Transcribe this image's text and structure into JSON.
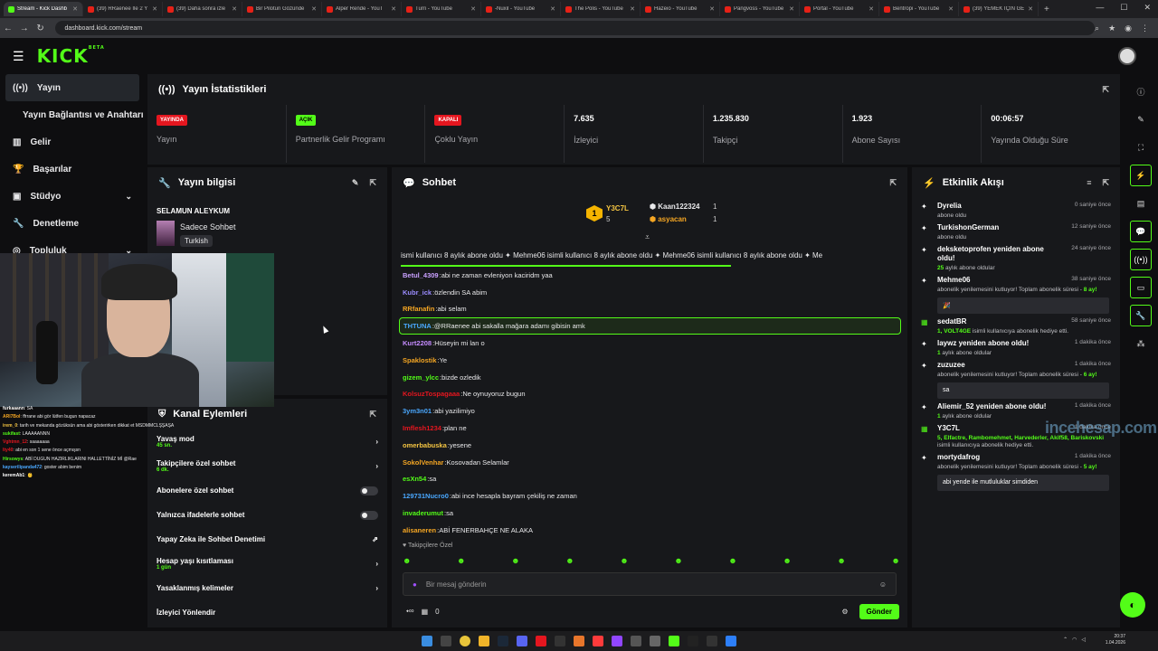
{
  "browser": {
    "tabs": [
      {
        "label": "Stream - Kick Dashb",
        "active": true
      },
      {
        "label": "(39) RRaenee İle 2 Y"
      },
      {
        "label": "(39) Daha sonra izle"
      },
      {
        "label": "Bir Pilotun Gözünde"
      },
      {
        "label": "Alper Rende - YouT"
      },
      {
        "label": "Turri - YouTube"
      },
      {
        "label": "-Nuxil - YouTube"
      },
      {
        "label": "The Polis - YouTube"
      },
      {
        "label": "Hazeio - YouTube"
      },
      {
        "label": "Pangvoss - YouTube"
      },
      {
        "label": "Portal - YouTube"
      },
      {
        "label": "Bentropi - YouTube"
      },
      {
        "label": "(39) YEMEK İÇİN GE"
      }
    ],
    "new_tab": "+",
    "url": "dashboard.kick.com/stream"
  },
  "app": {
    "logo": "KICK",
    "logo_beta": "BETA"
  },
  "sidebar": {
    "items": [
      {
        "label": "Yayın",
        "icon": "broadcast-icon"
      },
      {
        "label": "Yayın Bağlantısı ve Anahtarı"
      },
      {
        "label": "Gelir",
        "icon": "chart-icon"
      },
      {
        "label": "Başarılar",
        "icon": "trophy-icon"
      },
      {
        "label": "Stüdyo",
        "icon": "studio-icon"
      },
      {
        "label": "Denetleme",
        "icon": "wrench-icon"
      },
      {
        "label": "Topluluk",
        "icon": "community-icon"
      }
    ]
  },
  "stats": {
    "title": "Yayın İstatistikleri",
    "items": [
      {
        "badge": "YAYINDA",
        "label": "Yayın"
      },
      {
        "badge": "AÇIK",
        "label": "Partnerlik Gelir Programı"
      },
      {
        "badge": "KAPALI",
        "label": "Çoklu Yayın"
      },
      {
        "value": "7.635",
        "label": "İzleyici"
      },
      {
        "value": "1.235.830",
        "label": "Takipçi"
      },
      {
        "value": "1.923",
        "label": "Abone Sayısı"
      },
      {
        "value": "00:06:57",
        "label": "Yayında Olduğu Süre"
      }
    ]
  },
  "info": {
    "title": "Yayın bilgisi",
    "stream_title": "SELAMUN ALEYKUM",
    "category": "Sadece Sohbet",
    "language": "Turkish"
  },
  "actions": {
    "title": "Kanal Eylemleri",
    "items": [
      {
        "label": "Yavaş mod",
        "sub": "45 sn."
      },
      {
        "label": "Takipçilere özel sohbet",
        "sub": "6 dk."
      },
      {
        "label": "Abonelere özel sohbet"
      },
      {
        "label": "Yalnızca ifadelerle sohbet"
      },
      {
        "label": "Yapay Zeka ile Sohbet Denetimi"
      },
      {
        "label": "Hesap yaşı kısıtlaması",
        "sub": "1 gün"
      },
      {
        "label": "Yasaklanmış kelimeler"
      },
      {
        "label": "İzleyici Yönlendir"
      }
    ]
  },
  "chat": {
    "title": "Sohbet",
    "top": {
      "first_rank": "1",
      "first_name": "Y3C7L",
      "first_count": "5",
      "second_name": "Kaan122324",
      "second_count": "1",
      "third_name": "asyacan",
      "third_count": "1"
    },
    "ticker": "ismi kullanıcı 8 aylık abone oldu ✦ Mehme06 isimli kullanıcı 8 aylık abone oldu ✦ Mehme06 isimli kullanıcı 8 aylık abone oldu ✦ Me",
    "messages": [
      {
        "user": "Betul_4309",
        "text": " abi ne zaman evleniyon kaciridm yaa",
        "color": "#c9a0ff"
      },
      {
        "user": "Kubr_ick",
        "text": " özlendin SA abim",
        "color": "#9b8cff"
      },
      {
        "user": "RRfanafin",
        "text": " abi selam",
        "color": "#f5a623"
      },
      {
        "user": "THTUNA",
        "text": " @RRaenee abi sakalla mağara adamı gibisin amk",
        "color": "#4aa8ff",
        "highlight": true
      },
      {
        "user": "Kurt2208",
        "text": " Hüseyin mi lan o",
        "color": "#c58cff"
      },
      {
        "user": "Spaklostik",
        "text": " Ye",
        "color": "#f5a623"
      },
      {
        "user": "gizem_ylcc",
        "text": " bizde ozledik",
        "color": "#53fc18"
      },
      {
        "user": "KolsuzTospagaaa",
        "text": " Ne oynuyoruz bugun",
        "color": "#e5161f"
      },
      {
        "user": "3ym3n01",
        "text": " abi yazilimiyo",
        "color": "#4aa8ff"
      },
      {
        "user": "Imflesh1234",
        "text": " plan ne",
        "color": "#e5161f"
      },
      {
        "user": "omerbabuska",
        "text": " yesene",
        "color": "#f5c542"
      },
      {
        "user": "SokolVenhar",
        "text": " Kosovadan Selamlar",
        "color": "#f5a623"
      },
      {
        "user": "esXn54",
        "text": " sa",
        "color": "#53fc18"
      },
      {
        "user": "129731Nucro0",
        "text": " abi ince hesapla bayram çekiliş ne zaman",
        "color": "#4aa8ff"
      },
      {
        "user": "invaderumut",
        "text": " sa",
        "color": "#53fc18"
      },
      {
        "user": "alisaneren",
        "text": " ABİ FENERBAHÇE NE ALAKA",
        "color": "#f5a623"
      }
    ],
    "followers_label": "Takipçilere Özel",
    "input_placeholder": "Bir mesaj gönderin",
    "footer_count": "0",
    "send": "Gönder"
  },
  "activity": {
    "title": "Etkinlik Akışı",
    "events": [
      {
        "name": "Dyrelia",
        "desc": "abone oldu",
        "time": "0 saniye önce"
      },
      {
        "name": "TurkishonGerman",
        "desc": "abone oldu",
        "time": "12 saniye önce"
      },
      {
        "name": "deksketoprofen yeniden abone oldu!",
        "desc_green": "25",
        "desc": " aylık abone oldular",
        "time": "24 saniye önce"
      },
      {
        "name": "Mehme06",
        "desc": "abonelik yenilemesini kutluyor! Toplam abonelik süresi - ",
        "desc_green": "8 ay!",
        "time": "38 saniye önce",
        "box": "🎉"
      },
      {
        "name": "sedatBR",
        "desc_green": "1, VOLT4GE",
        "desc": " isimli kullanıcıya abonelik hediye etti.",
        "time": "58 saniye önce"
      },
      {
        "name": "laywz yeniden abone oldu!",
        "desc_green": "1",
        "desc": " aylık abone oldular",
        "time": "1 dakika önce"
      },
      {
        "name": "zuzuzee",
        "desc": "abonelik yenilemesini kutluyor! Toplam abonelik süresi - ",
        "desc_green": "6 ay!",
        "time": "1 dakika önce",
        "box": "sa"
      },
      {
        "name": "Aliemir_52 yeniden abone oldu!",
        "desc_green": "1",
        "desc": " aylık abone oldular",
        "time": "1 dakika önce"
      },
      {
        "name": "Y3C7L",
        "desc_green": "5, Elfactre, Rambomehmet, Harvederler, Akif58, Bariskovski",
        "desc": " isimli kullanıcıya abonelik hediye etti.",
        "time": "1 dakika önce"
      },
      {
        "name": "mortydafrog",
        "desc": "abonelik yenilemesini kutluyor! Toplam abonelik süresi - ",
        "desc_green": "5 ay!",
        "time": "1 dakika önce",
        "box": "abi yende ile mutluluklar simdiden"
      }
    ]
  },
  "overlay": {
    "watermark": "incehesap.com",
    "chat": [
      {
        "user": "furkaaann",
        "text": " SA"
      },
      {
        "user": "ARI7Bol",
        "text": " ffrrane abi gör lütfen bugun napacaz"
      },
      {
        "user": "irem_0",
        "text": " tarih ve mekanda gözüksün ama abi gösterirken dikkat et MSDMMCLŞŞAŞA"
      },
      {
        "user": "sukifast",
        "text": " LAAAAANNN"
      },
      {
        "user": "Vghtmn_12",
        "text": " saaaaaaa"
      },
      {
        "user": "lty40",
        "text": " abi en son 1 sene önce açmışsn"
      },
      {
        "user": "Hirsowys",
        "text": " ABİ DUGUN HAZIRLIKLARINI HALLETTİNİZ Mİ @Rae"
      },
      {
        "user": "kayserilipanda472",
        "text": " goster abim benim"
      },
      {
        "user": "keremAb1",
        "text": " 👶"
      }
    ]
  },
  "taskbar": {
    "time": "20:37",
    "date": "1.04.2026"
  }
}
